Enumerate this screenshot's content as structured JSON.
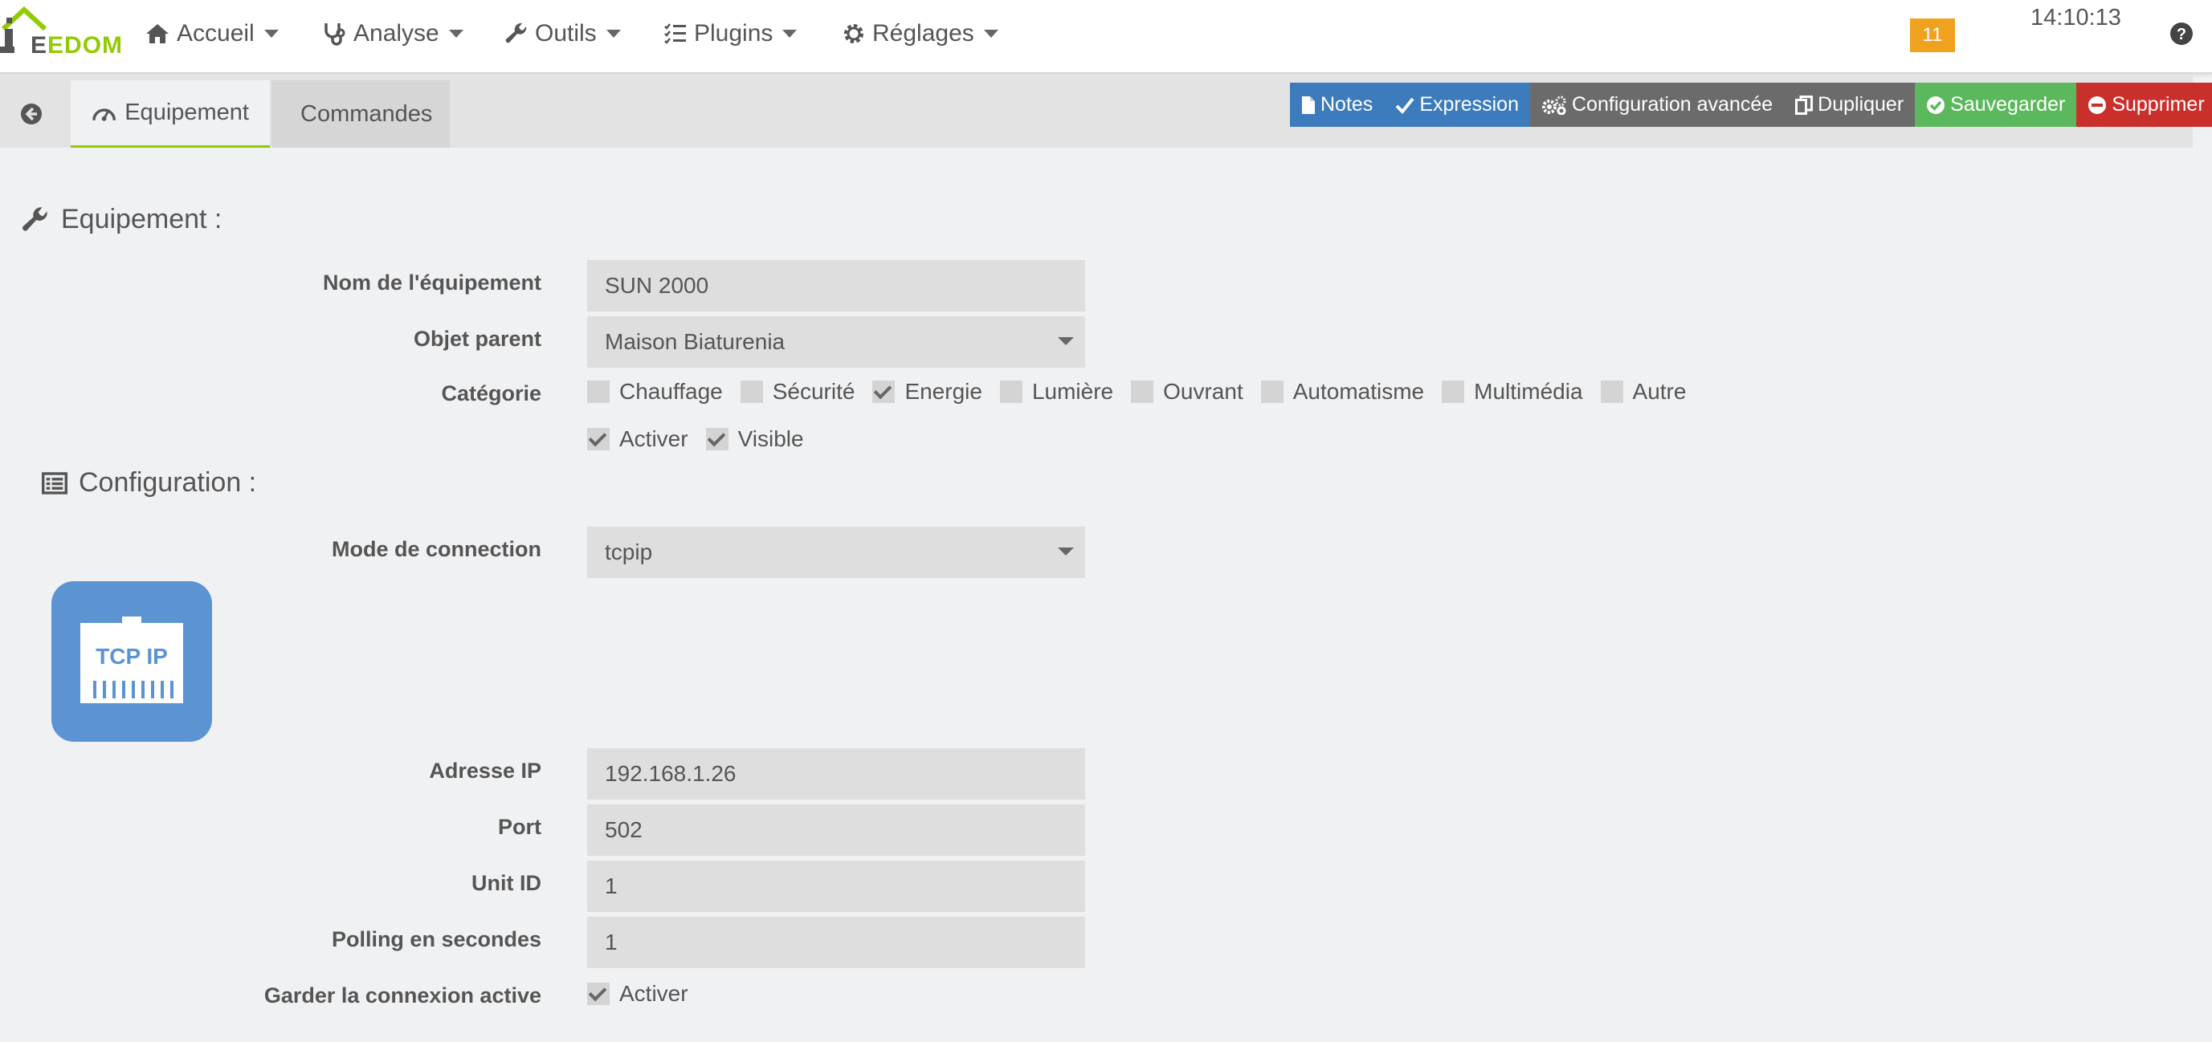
{
  "navbar": {
    "logo_text_prefix": "E",
    "logo_text_suffix": "EDOM",
    "menus": [
      {
        "label": "Accueil",
        "icon": "home-icon"
      },
      {
        "label": "Analyse",
        "icon": "stethoscope-icon"
      },
      {
        "label": "Outils",
        "icon": "wrench-icon"
      },
      {
        "label": "Plugins",
        "icon": "list-check-icon"
      },
      {
        "label": "Réglages",
        "icon": "gear-icon"
      }
    ],
    "notification_count": "11",
    "clock": "14:10:13"
  },
  "tabs": {
    "back_icon": "arrow-left-circle-icon",
    "items": [
      {
        "label": "Equipement",
        "icon": "dashboard-icon",
        "active": true
      },
      {
        "label": "Commandes",
        "icon": "list-icon",
        "active": false
      }
    ]
  },
  "actions": [
    {
      "label": "Notes",
      "icon": "file-icon",
      "color": "#3c7bbc"
    },
    {
      "label": "Expression",
      "icon": "check-icon",
      "color": "#3c7bbc"
    },
    {
      "label": "Configuration avancée",
      "icon": "gears-icon",
      "color": "#6b6b6b"
    },
    {
      "label": "Dupliquer",
      "icon": "copy-icon",
      "color": "#6b6b6b"
    },
    {
      "label": "Sauvegarder",
      "icon": "check-circle-icon",
      "color": "#5cb85c"
    },
    {
      "label": "Supprimer",
      "icon": "minus-circle-icon",
      "color": "#c9302c"
    }
  ],
  "equipement": {
    "section_title": "Equipement :",
    "name_label": "Nom de l'équipement",
    "name_value": "SUN 2000",
    "parent_label": "Objet parent",
    "parent_value": "Maison Biaturenia",
    "category_label": "Catégorie",
    "categories": [
      {
        "label": "Chauffage",
        "checked": false
      },
      {
        "label": "Sécurité",
        "checked": false
      },
      {
        "label": "Energie",
        "checked": true
      },
      {
        "label": "Lumière",
        "checked": false
      },
      {
        "label": "Ouvrant",
        "checked": false
      },
      {
        "label": "Automatisme",
        "checked": false
      },
      {
        "label": "Multimédia",
        "checked": false
      },
      {
        "label": "Autre",
        "checked": false
      }
    ],
    "flags": [
      {
        "label": "Activer",
        "checked": true
      },
      {
        "label": "Visible",
        "checked": true
      }
    ]
  },
  "configuration": {
    "section_title": "Configuration :",
    "mode_label": "Mode de connection",
    "mode_value": "tcpip",
    "tcp_logo_text": "TCP IP",
    "ip_label": "Adresse IP",
    "ip_value": "192.168.1.26",
    "port_label": "Port",
    "port_value": "502",
    "unit_label": "Unit ID",
    "unit_value": "1",
    "polling_label": "Polling en secondes",
    "polling_value": "1",
    "keepalive_label": "Garder la connexion active",
    "keepalive_option": "Activer",
    "keepalive_checked": true
  },
  "colors": {
    "accent_green": "#94ca02",
    "badge_orange": "#f0a21e",
    "tcp_blue": "#5b93d3"
  }
}
